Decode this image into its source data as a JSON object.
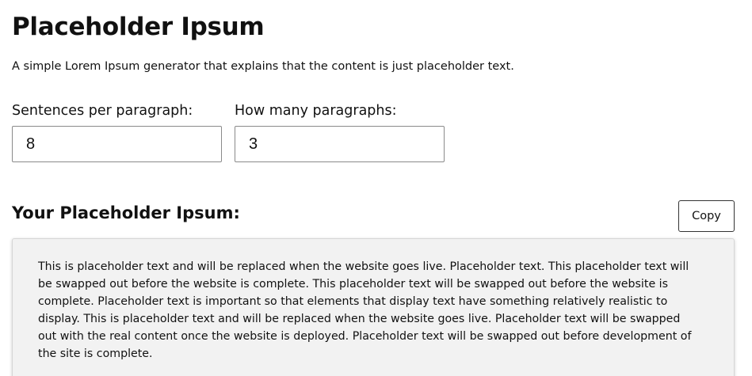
{
  "header": {
    "title": "Placeholder Ipsum",
    "subtitle": "A simple Lorem Ipsum generator that explains that the content is just placeholder text."
  },
  "form": {
    "sentences": {
      "label": "Sentences per paragraph:",
      "value": "8"
    },
    "paragraphs": {
      "label": "How many paragraphs:",
      "value": "3"
    }
  },
  "output": {
    "heading": "Your Placeholder Ipsum:",
    "copy_label": "Copy",
    "paragraphs": [
      "This is placeholder text and will be replaced when the website goes live. Placeholder text. This placeholder text will be swapped out before the website is complete. This placeholder text will be swapped out before the website is complete. Placeholder text is important so that elements that display text have something relatively realistic to display. This is placeholder text and will be replaced when the website goes live. Placeholder text will be swapped out with the real content once the website is deployed. Placeholder text will be swapped out before development of the site is complete."
    ]
  }
}
